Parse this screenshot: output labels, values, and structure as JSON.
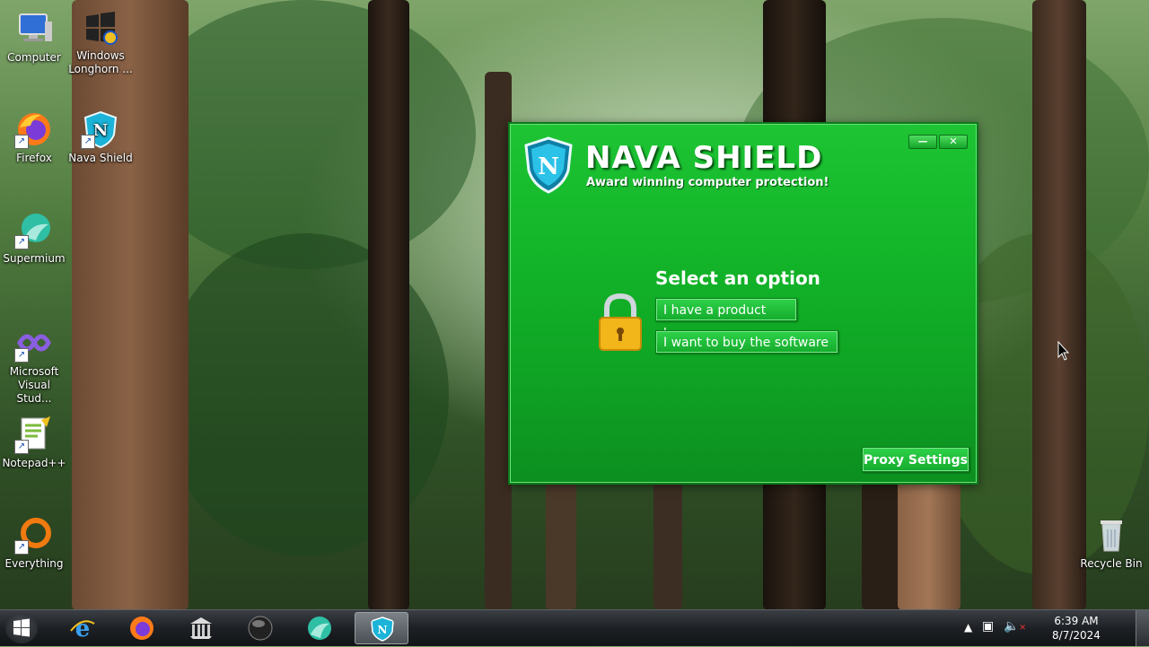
{
  "desktop": {
    "icons": [
      {
        "label": "Computer",
        "icon": "computer-icon"
      },
      {
        "label": "Windows Longhorn ...",
        "icon": "windows-logo-icon"
      },
      {
        "label": "Firefox",
        "icon": "firefox-icon"
      },
      {
        "label": "Nava Shield",
        "icon": "nava-shield-icon"
      },
      {
        "label": "Supermium",
        "icon": "supermium-icon"
      },
      {
        "label": "Microsoft Visual Stud...",
        "icon": "visual-studio-icon"
      },
      {
        "label": "Notepad++",
        "icon": "notepadpp-icon"
      },
      {
        "label": "Everything",
        "icon": "everything-icon"
      },
      {
        "label": "Recycle Bin",
        "icon": "recycle-bin-icon"
      }
    ]
  },
  "nava_window": {
    "title": "NAVA SHIELD",
    "tagline": "Award winning computer protection!",
    "minimize_label": "—",
    "close_label": "✕",
    "select_title": "Select an option",
    "product_key_label": "I have a product key.",
    "buy_label": "I want to buy the software",
    "proxy_label": "Proxy Settings",
    "colors": {
      "window_green": "#14b82a",
      "button_green": "#1fbf38"
    }
  },
  "taskbar": {
    "items": [
      "start-button",
      "internet-explorer-icon",
      "firefox-icon",
      "library-icon",
      "media-player-icon",
      "supermium-icon",
      "nava-shield-icon"
    ],
    "active_item": "nava-shield-icon",
    "clock_time": "6:39 AM",
    "clock_date": "8/7/2024"
  }
}
